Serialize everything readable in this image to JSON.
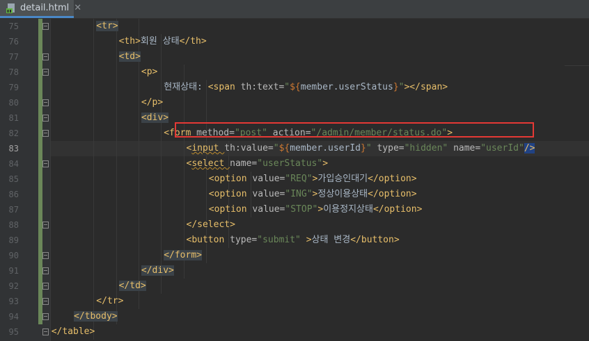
{
  "tab": {
    "filename": "detail.html",
    "close": "✕",
    "icon": "html-file-icon"
  },
  "colors": {
    "background": "#2b2b2b",
    "gutter": "#313335",
    "tag": "#e8bf6a",
    "attribute": "#bababa",
    "string": "#6a8759",
    "text": "#a9b7c6",
    "highlight": "#e53935",
    "change_bar": "#6a8759"
  },
  "editor": {
    "current_line": "83",
    "lines": [
      {
        "num": "75",
        "indent": 4,
        "parts": [
          [
            "b",
            "<"
          ],
          [
            "t",
            "tr"
          ],
          [
            "b",
            ">"
          ]
        ],
        "tagbg": true
      },
      {
        "num": "76",
        "indent": 5,
        "parts": [
          [
            "b",
            "<"
          ],
          [
            "t",
            "th"
          ],
          [
            "b",
            ">"
          ],
          [
            "x",
            "회원 상태"
          ],
          [
            "b",
            "</"
          ],
          [
            "t",
            "th"
          ],
          [
            "b",
            ">"
          ]
        ]
      },
      {
        "num": "77",
        "indent": 5,
        "parts": [
          [
            "b",
            "<"
          ],
          [
            "t",
            "td"
          ],
          [
            "b",
            ">"
          ]
        ],
        "tagbg": true
      },
      {
        "num": "78",
        "indent": 6,
        "parts": [
          [
            "b",
            "<"
          ],
          [
            "t",
            "p"
          ],
          [
            "b",
            ">"
          ]
        ]
      },
      {
        "num": "79",
        "indent": 7,
        "parts": [
          [
            "x",
            "현재상태: "
          ],
          [
            "b",
            "<"
          ],
          [
            "t",
            "span "
          ],
          [
            "a",
            "th:text="
          ],
          [
            "s",
            "\""
          ],
          [
            "d",
            "${"
          ],
          [
            "e",
            "member.userStatus"
          ],
          [
            "d",
            "}"
          ],
          [
            "s",
            "\""
          ],
          [
            "b",
            "></"
          ],
          [
            "t",
            "span"
          ],
          [
            "b",
            ">"
          ]
        ]
      },
      {
        "num": "80",
        "indent": 6,
        "parts": [
          [
            "b",
            "</"
          ],
          [
            "t",
            "p"
          ],
          [
            "b",
            ">"
          ]
        ]
      },
      {
        "num": "81",
        "indent": 6,
        "parts": [
          [
            "b",
            "<"
          ],
          [
            "t",
            "div"
          ],
          [
            "b",
            ">"
          ]
        ],
        "tagbg": true
      },
      {
        "num": "82",
        "indent": 7,
        "parts": [
          [
            "b",
            "<"
          ],
          [
            "t",
            "form "
          ],
          [
            "a",
            "method="
          ],
          [
            "s",
            "\"post\" "
          ],
          [
            "a",
            "action="
          ],
          [
            "s",
            "\"/admin/member/status.do\""
          ],
          [
            "b",
            ">"
          ]
        ]
      },
      {
        "num": "83",
        "indent": 8,
        "parts": [
          [
            "b",
            "<"
          ],
          [
            "t",
            "input "
          ],
          [
            "a",
            "th:value="
          ],
          [
            "s",
            "\""
          ],
          [
            "d",
            "${"
          ],
          [
            "e",
            "member.userId"
          ],
          [
            "d",
            "}"
          ],
          [
            "s",
            "\" "
          ],
          [
            "a",
            "type="
          ],
          [
            "s",
            "\"hidden\" "
          ],
          [
            "a",
            "name="
          ],
          [
            "s",
            "\"userId\""
          ],
          [
            "b",
            "/>"
          ]
        ]
      },
      {
        "num": "84",
        "indent": 8,
        "parts": [
          [
            "b",
            "<"
          ],
          [
            "t",
            "select "
          ],
          [
            "a",
            "name="
          ],
          [
            "s",
            "\"userStatus\""
          ],
          [
            "b",
            ">"
          ]
        ]
      },
      {
        "num": "85",
        "indent": 9,
        "parts": [
          [
            "b",
            "<"
          ],
          [
            "t",
            "option "
          ],
          [
            "a",
            "value="
          ],
          [
            "s",
            "\"REQ\""
          ],
          [
            "b",
            ">"
          ],
          [
            "x",
            "가입승인대기"
          ],
          [
            "b",
            "</"
          ],
          [
            "t",
            "option"
          ],
          [
            "b",
            ">"
          ]
        ]
      },
      {
        "num": "86",
        "indent": 9,
        "parts": [
          [
            "b",
            "<"
          ],
          [
            "t",
            "option "
          ],
          [
            "a",
            "value="
          ],
          [
            "s",
            "\"ING\""
          ],
          [
            "b",
            ">"
          ],
          [
            "x",
            "정상이용상태"
          ],
          [
            "b",
            "</"
          ],
          [
            "t",
            "option"
          ],
          [
            "b",
            ">"
          ]
        ]
      },
      {
        "num": "87",
        "indent": 9,
        "parts": [
          [
            "b",
            "<"
          ],
          [
            "t",
            "option "
          ],
          [
            "a",
            "value="
          ],
          [
            "s",
            "\"STOP\""
          ],
          [
            "b",
            ">"
          ],
          [
            "x",
            "이용정지상태"
          ],
          [
            "b",
            "</"
          ],
          [
            "t",
            "option"
          ],
          [
            "b",
            ">"
          ]
        ]
      },
      {
        "num": "88",
        "indent": 8,
        "parts": [
          [
            "b",
            "</"
          ],
          [
            "t",
            "select"
          ],
          [
            "b",
            ">"
          ]
        ]
      },
      {
        "num": "89",
        "indent": 8,
        "parts": [
          [
            "b",
            "<"
          ],
          [
            "t",
            "button "
          ],
          [
            "a",
            "type="
          ],
          [
            "s",
            "\"submit\" "
          ],
          [
            "b",
            ">"
          ],
          [
            "x",
            "상태 변경"
          ],
          [
            "b",
            "</"
          ],
          [
            "t",
            "button"
          ],
          [
            "b",
            ">"
          ]
        ]
      },
      {
        "num": "90",
        "indent": 7,
        "parts": [
          [
            "b",
            "</"
          ],
          [
            "t",
            "form"
          ],
          [
            "b",
            ">"
          ]
        ],
        "tagbg": true
      },
      {
        "num": "91",
        "indent": 6,
        "parts": [
          [
            "b",
            "</"
          ],
          [
            "t",
            "div"
          ],
          [
            "b",
            ">"
          ]
        ],
        "tagbg": true
      },
      {
        "num": "92",
        "indent": 5,
        "parts": [
          [
            "b",
            "</"
          ],
          [
            "t",
            "td"
          ],
          [
            "b",
            ">"
          ]
        ],
        "tagbg": true
      },
      {
        "num": "93",
        "indent": 4,
        "parts": [
          [
            "b",
            "</"
          ],
          [
            "t",
            "tr"
          ],
          [
            "b",
            ">"
          ]
        ]
      },
      {
        "num": "94",
        "indent": 3,
        "parts": [
          [
            "b",
            "</"
          ],
          [
            "t",
            "tbody"
          ],
          [
            "b",
            ">"
          ]
        ],
        "tagbg": true
      },
      {
        "num": "95",
        "indent": 2,
        "parts": [
          [
            "b",
            "</"
          ],
          [
            "t",
            "table"
          ],
          [
            "b",
            ">"
          ]
        ]
      }
    ]
  }
}
